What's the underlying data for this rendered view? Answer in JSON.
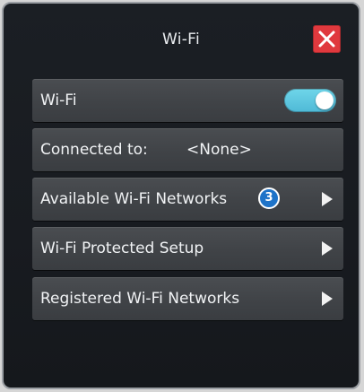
{
  "header": {
    "title": "Wi-Fi",
    "close_icon": "close-icon",
    "close_color": "#e0393e"
  },
  "wifi_row": {
    "label": "Wi-Fi",
    "toggle_on": true,
    "toggle_color": "#5cc6df"
  },
  "connected_row": {
    "label": "Connected to:",
    "value": "<None>"
  },
  "available_row": {
    "label": "Available Wi-Fi Networks",
    "count": "3",
    "badge_color": "#1e73c8",
    "arrow_icon": "chevron-right-icon"
  },
  "wps_row": {
    "label": "Wi-Fi Protected Setup",
    "arrow_icon": "chevron-right-icon"
  },
  "registered_row": {
    "label": "Registered Wi-Fi Networks",
    "arrow_icon": "chevron-right-icon"
  }
}
